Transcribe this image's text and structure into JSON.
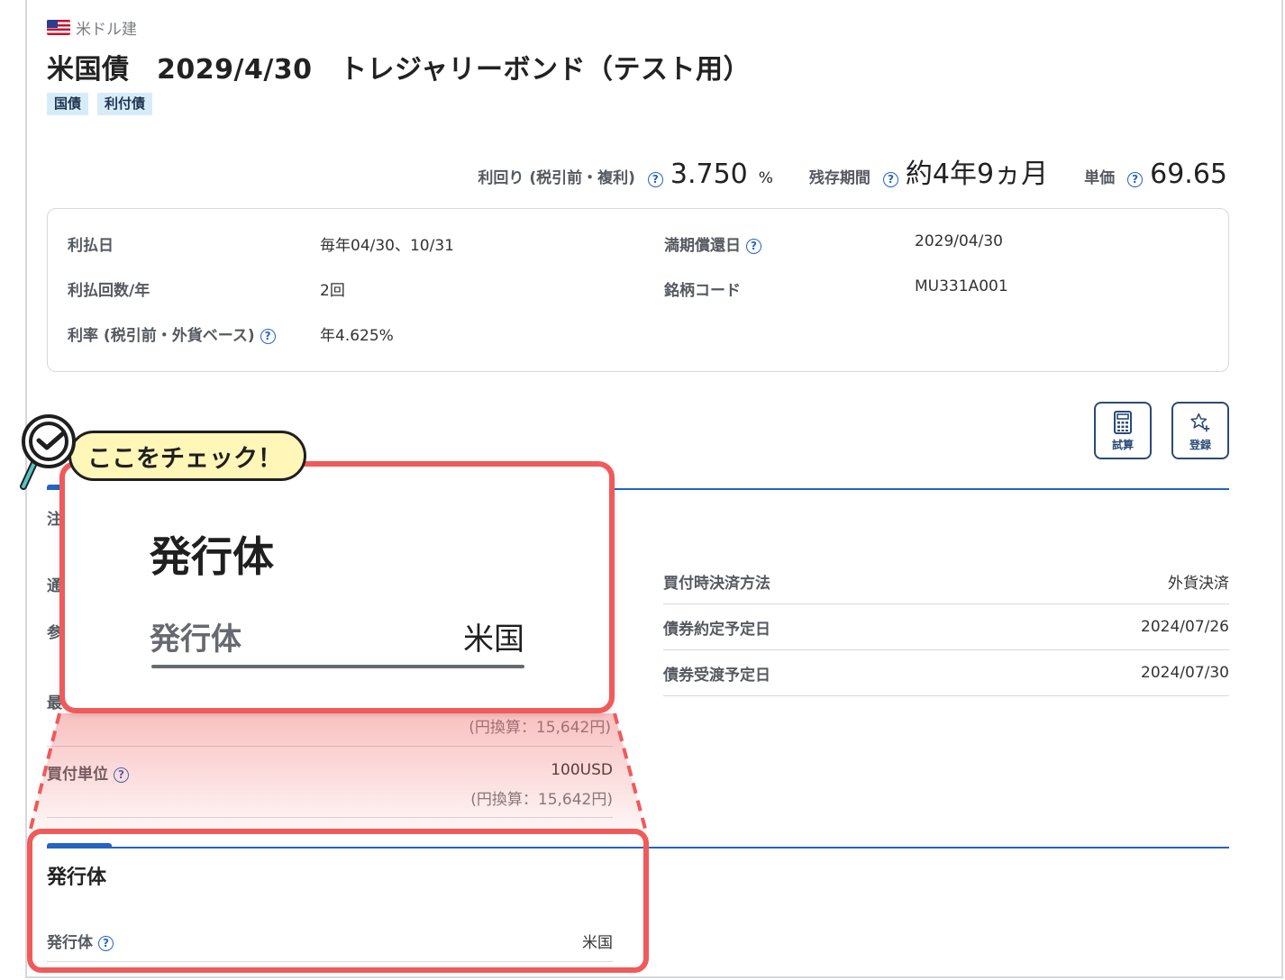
{
  "header": {
    "currency_label": "米ドル建",
    "title": "米国債　2029/4/30　トレジャリーボンド（テスト用）",
    "tags": [
      "国債",
      "利付債"
    ]
  },
  "metrics": {
    "yield": {
      "label": "利回り (税引前・複利)",
      "value": "3.750",
      "unit": "%"
    },
    "remaining": {
      "label": "残存期間",
      "value": "約4年9ヵ月"
    },
    "price": {
      "label": "単価",
      "value": "69.65"
    }
  },
  "info": {
    "payment_dates_label": "利払日",
    "payment_dates_value": "毎年04/30、10/31",
    "maturity_label": "満期償還日",
    "maturity_value": "2029/04/30",
    "frequency_label": "利払回数/年",
    "frequency_value": "2回",
    "code_label": "銘柄コード",
    "code_value": "MU331A001",
    "rate_label": "利率 (税引前・外貨ベース)",
    "rate_value": "年4.625%"
  },
  "buttons": {
    "calc_label": "試算",
    "register_label": "登録"
  },
  "order": {
    "rows": [
      {
        "label": "買付時決済方法",
        "value": "外貨決済"
      },
      {
        "label": "債券約定予定日",
        "value": "2024/07/26"
      },
      {
        "label": "債券受渡予定日",
        "value": "2024/07/30"
      }
    ],
    "stubs": [
      "注",
      "通",
      "参",
      "最"
    ],
    "prev_yen_sub": "(円換算：15,642円)",
    "unit_label": "買付単位",
    "unit_value": "100USD",
    "unit_yen_sub": "(円換算：15,642円)"
  },
  "issuer": {
    "section_title": "発行体",
    "label": "発行体",
    "value": "米国"
  },
  "callout": {
    "badge_text": "ここをチェック！",
    "zoom_title": "発行体",
    "zoom_label": "発行体",
    "zoom_value": "米国"
  },
  "colors": {
    "accent_blue": "#2563c4",
    "highlight_red": "#f05a5a",
    "badge_yellow": "#fff6b8",
    "tag_bg": "#d8ecf8"
  }
}
